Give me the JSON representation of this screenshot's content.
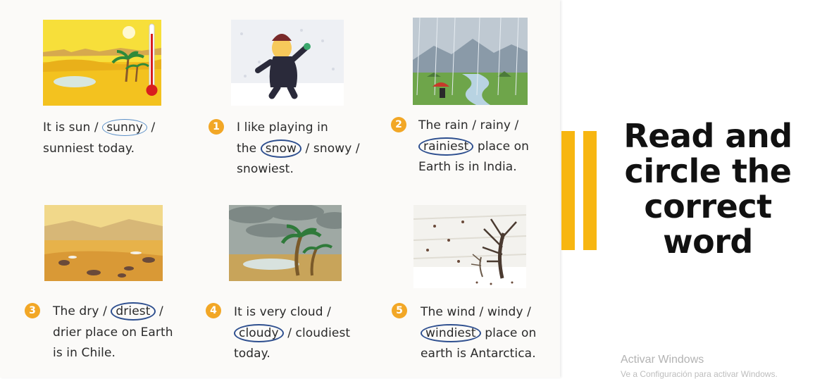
{
  "title": {
    "lines": [
      "Read and",
      "circle the",
      "correct",
      "word"
    ]
  },
  "watermark": {
    "line1": "Activar Windows",
    "line2": "Ve a Configuración para activar Windows."
  },
  "items": [
    {
      "number": "",
      "illustration": "sunny-desert-thermometer",
      "lines": [
        {
          "pre": "It is sun / ",
          "circled": "sunny",
          "post": " /"
        },
        {
          "pre": "sunniest today.",
          "circled": "",
          "post": ""
        }
      ]
    },
    {
      "number": "1",
      "illustration": "child-in-snow",
      "lines": [
        {
          "pre": "I like playing in",
          "circled": "",
          "post": ""
        },
        {
          "pre": "the ",
          "circled": "snow",
          "post": " / snowy /"
        },
        {
          "pre": "snowiest.",
          "circled": "",
          "post": ""
        }
      ]
    },
    {
      "number": "2",
      "illustration": "rainy-valley",
      "lines": [
        {
          "pre": "The rain / rainy /",
          "circled": "",
          "post": ""
        },
        {
          "pre": "",
          "circled": "rainiest",
          "post": " place on"
        },
        {
          "pre": "Earth is in India.",
          "circled": "",
          "post": ""
        }
      ]
    },
    {
      "number": "3",
      "illustration": "dry-desert",
      "lines": [
        {
          "pre": "The dry / ",
          "circled": "driest",
          "post": " /"
        },
        {
          "pre": "drier place on Earth",
          "circled": "",
          "post": ""
        },
        {
          "pre": "is in Chile.",
          "circled": "",
          "post": ""
        }
      ]
    },
    {
      "number": "4",
      "illustration": "cloudy-palms",
      "lines": [
        {
          "pre": "It is very cloud /",
          "circled": "",
          "post": ""
        },
        {
          "pre": "",
          "circled": "cloudy",
          "post": " / cloudiest"
        },
        {
          "pre": "today.",
          "circled": "",
          "post": ""
        }
      ]
    },
    {
      "number": "5",
      "illustration": "windy-tree",
      "lines": [
        {
          "pre": "The wind / windy /",
          "circled": "",
          "post": ""
        },
        {
          "pre": "",
          "circled": "windiest",
          "post": " place on"
        },
        {
          "pre": "earth is Antarctica.",
          "circled": "",
          "post": ""
        }
      ]
    }
  ],
  "colors": {
    "accent_bar": "#f7b611",
    "number_badge": "#f2a726",
    "circle_ink": "#2e4f8f"
  }
}
